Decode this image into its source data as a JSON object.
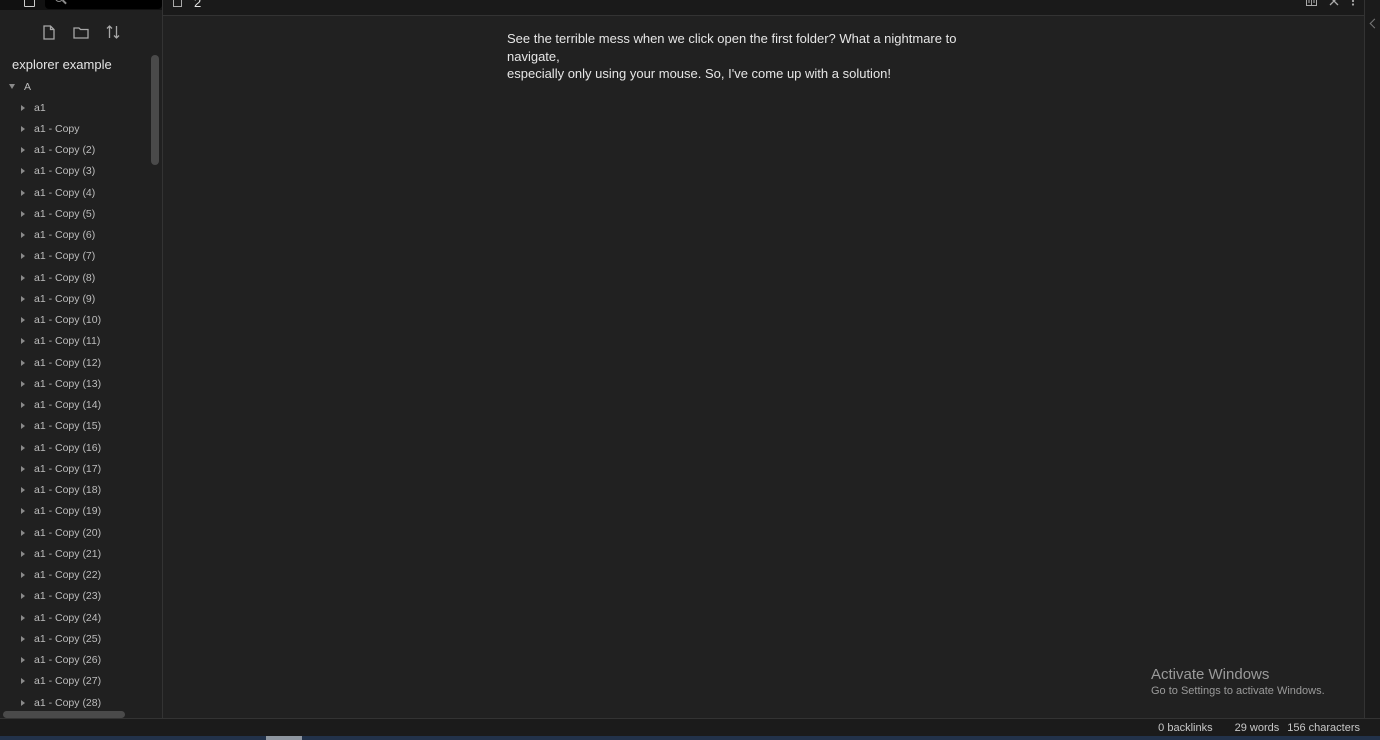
{
  "sidebar": {
    "vault_title": "explorer example",
    "root_folder": "A",
    "items": [
      "a1",
      "a1 - Copy",
      "a1 - Copy (2)",
      "a1 - Copy (3)",
      "a1 - Copy (4)",
      "a1 - Copy (5)",
      "a1 - Copy (6)",
      "a1 - Copy (7)",
      "a1 - Copy (8)",
      "a1 - Copy (9)",
      "a1 - Copy (10)",
      "a1 - Copy (11)",
      "a1 - Copy (12)",
      "a1 - Copy (13)",
      "a1 - Copy (14)",
      "a1 - Copy (15)",
      "a1 - Copy (16)",
      "a1 - Copy (17)",
      "a1 - Copy (18)",
      "a1 - Copy (19)",
      "a1 - Copy (20)",
      "a1 - Copy (21)",
      "a1 - Copy (22)",
      "a1 - Copy (23)",
      "a1 - Copy (24)",
      "a1 - Copy (25)",
      "a1 - Copy (26)",
      "a1 - Copy (27)",
      "a1 - Copy (28)"
    ],
    "toolbar_icons": [
      "new-note-icon",
      "new-folder-icon",
      "sort-icon"
    ]
  },
  "tab": {
    "title": "2",
    "action_icons": [
      "reading-view-icon",
      "close-icon",
      "more-options-icon"
    ]
  },
  "editor": {
    "line1": "See the terrible mess when we click open the first folder? What a nightmare to navigate,",
    "line2": "especially only using your mouse. So, I've come up with a solution!"
  },
  "watermark": {
    "title": "Activate Windows",
    "subtitle": "Go to Settings to activate Windows."
  },
  "statusbar": {
    "backlinks": "0 backlinks",
    "words": "29 words",
    "characters": "156 characters"
  }
}
